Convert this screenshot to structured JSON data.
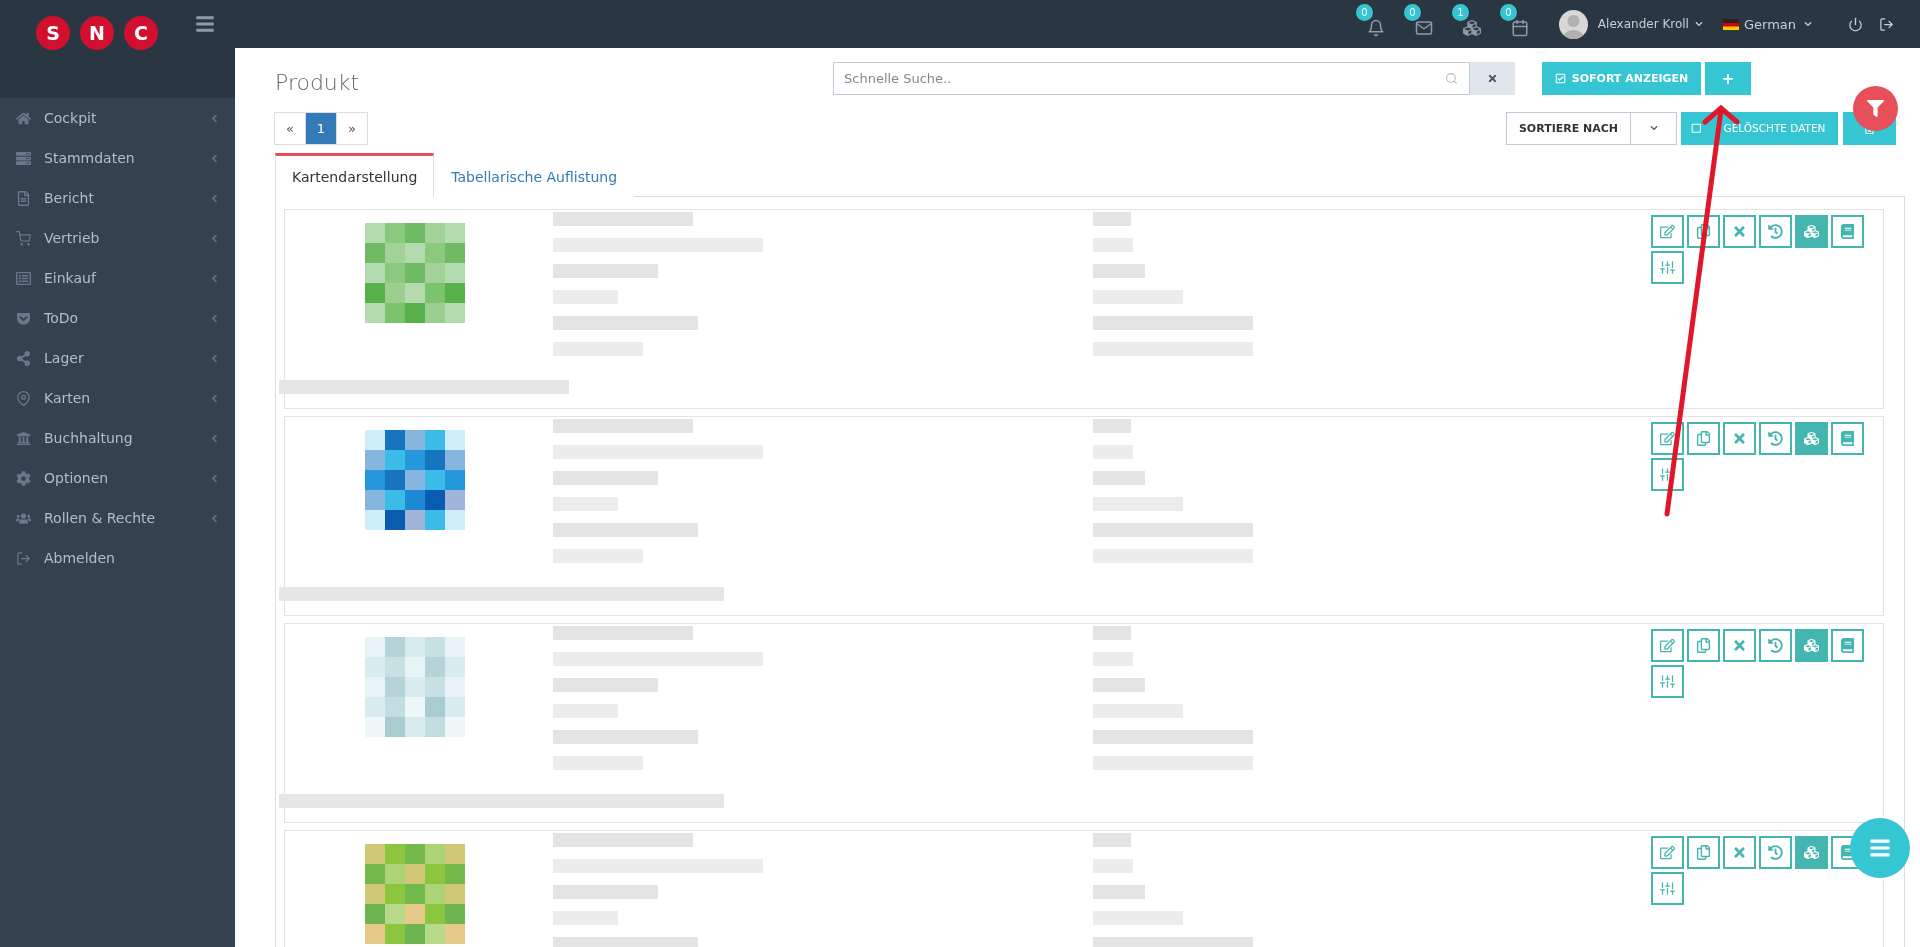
{
  "logo": {
    "letters": [
      "S",
      "N",
      "C"
    ]
  },
  "topbar": {
    "notifications": [
      {
        "count": "0"
      },
      {
        "count": "0"
      },
      {
        "count": "1"
      },
      {
        "count": "0"
      }
    ],
    "user": "Alexander Kroll",
    "language": "German"
  },
  "sidebar": {
    "items": [
      {
        "label": "Cockpit",
        "has_submenu": true
      },
      {
        "label": "Stammdaten",
        "has_submenu": true
      },
      {
        "label": "Bericht",
        "has_submenu": true
      },
      {
        "label": "Vertrieb",
        "has_submenu": true
      },
      {
        "label": "Einkauf",
        "has_submenu": true
      },
      {
        "label": "ToDo",
        "has_submenu": true
      },
      {
        "label": "Lager",
        "has_submenu": true
      },
      {
        "label": "Karten",
        "has_submenu": true
      },
      {
        "label": "Buchhaltung",
        "has_submenu": true
      },
      {
        "label": "Optionen",
        "has_submenu": true
      },
      {
        "label": "Rollen & Rechte",
        "has_submenu": true
      },
      {
        "label": "Abmelden",
        "has_submenu": false
      }
    ]
  },
  "page": {
    "title": "Produkt"
  },
  "search": {
    "placeholder": "Schnelle Suche.."
  },
  "buttons": {
    "show_now": "SOFORT ANZEIGEN",
    "add": "+",
    "sort": "SORTIERE NACH",
    "deleted": "GELÖSCHTE DATEN"
  },
  "pagination": [
    {
      "label": "«",
      "selected": false
    },
    {
      "label": "1",
      "selected": true
    },
    {
      "label": "»",
      "selected": false
    }
  ],
  "tabs": [
    {
      "label": "Kartendarstellung",
      "selected": true
    },
    {
      "label": "Tabellarische Auflistung",
      "selected": false
    }
  ],
  "card_actions": [
    {
      "kind": "edit",
      "filled": false
    },
    {
      "kind": "copy",
      "filled": false
    },
    {
      "kind": "delete",
      "filled": false
    },
    {
      "kind": "history",
      "filled": false
    },
    {
      "kind": "stock",
      "filled": true
    },
    {
      "kind": "book",
      "filled": false
    },
    {
      "kind": "settings",
      "filled": false
    }
  ]
}
